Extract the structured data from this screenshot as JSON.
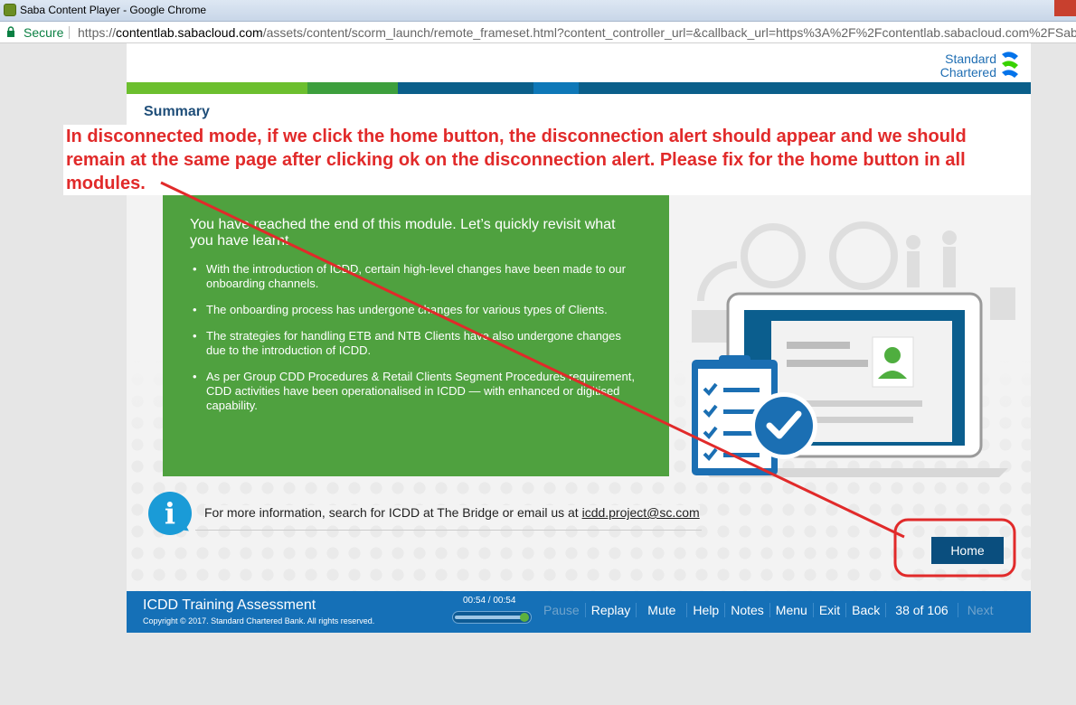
{
  "window": {
    "title": "Saba Content Player - Google Chrome"
  },
  "address": {
    "secure": "Secure",
    "url_prefix": "https://",
    "host": "contentlab.sabacloud.com",
    "path": "/assets/content/scorm_launch/remote_frameset.html?content_controller_url=&callback_url=https%3A%2F%2Fcontentlab.sabacloud.com%2FSaba"
  },
  "logo": {
    "line1": "Standard",
    "line2": "Chartered"
  },
  "slide": {
    "title": "Summary",
    "lead": "You have reached the end of this module. Let’s quickly revisit what you have learnt.",
    "bullets": [
      "With the introduction of ICDD, certain high-level changes have been made to our onboarding channels.",
      "The onboarding process has undergone changes for various types of Clients.",
      "The strategies for handling ETB and NTB Clients have also undergone changes due to the introduction of ICDD.",
      "As per Group CDD Procedures & Retail Clients Segment Procedures requirement, CDD activities have been operationalised in ICDD — with enhanced or digitised capability."
    ],
    "info_text": "For more information, search for ICDD at The Bridge or email us at ",
    "info_email": "icdd.project@sc.com",
    "home_label": "Home"
  },
  "footer": {
    "course_title": "ICDD Training Assessment",
    "copyright": "Copyright © 2017. Standard Chartered Bank. All rights reserved.",
    "time": "00:54 / 00:54",
    "progress": 1.0,
    "controls": {
      "pause": "Pause",
      "replay": "Replay",
      "mute": "Mute",
      "help": "Help",
      "notes": "Notes",
      "menu": "Menu",
      "exit": "Exit",
      "back": "Back",
      "page": "38 of 106",
      "next": "Next"
    }
  },
  "annotation": {
    "text": "In disconnected mode, if we click the home button, the disconnection alert should appear and we should remain at the same page after clicking ok on the disconnection alert. Please fix for the home button in all modules."
  },
  "colors": {
    "brand_blue": "#1570b7",
    "green_panel": "#4fa13f",
    "annotation_red": "#e12a2a",
    "home_button": "#0a4e7e"
  }
}
